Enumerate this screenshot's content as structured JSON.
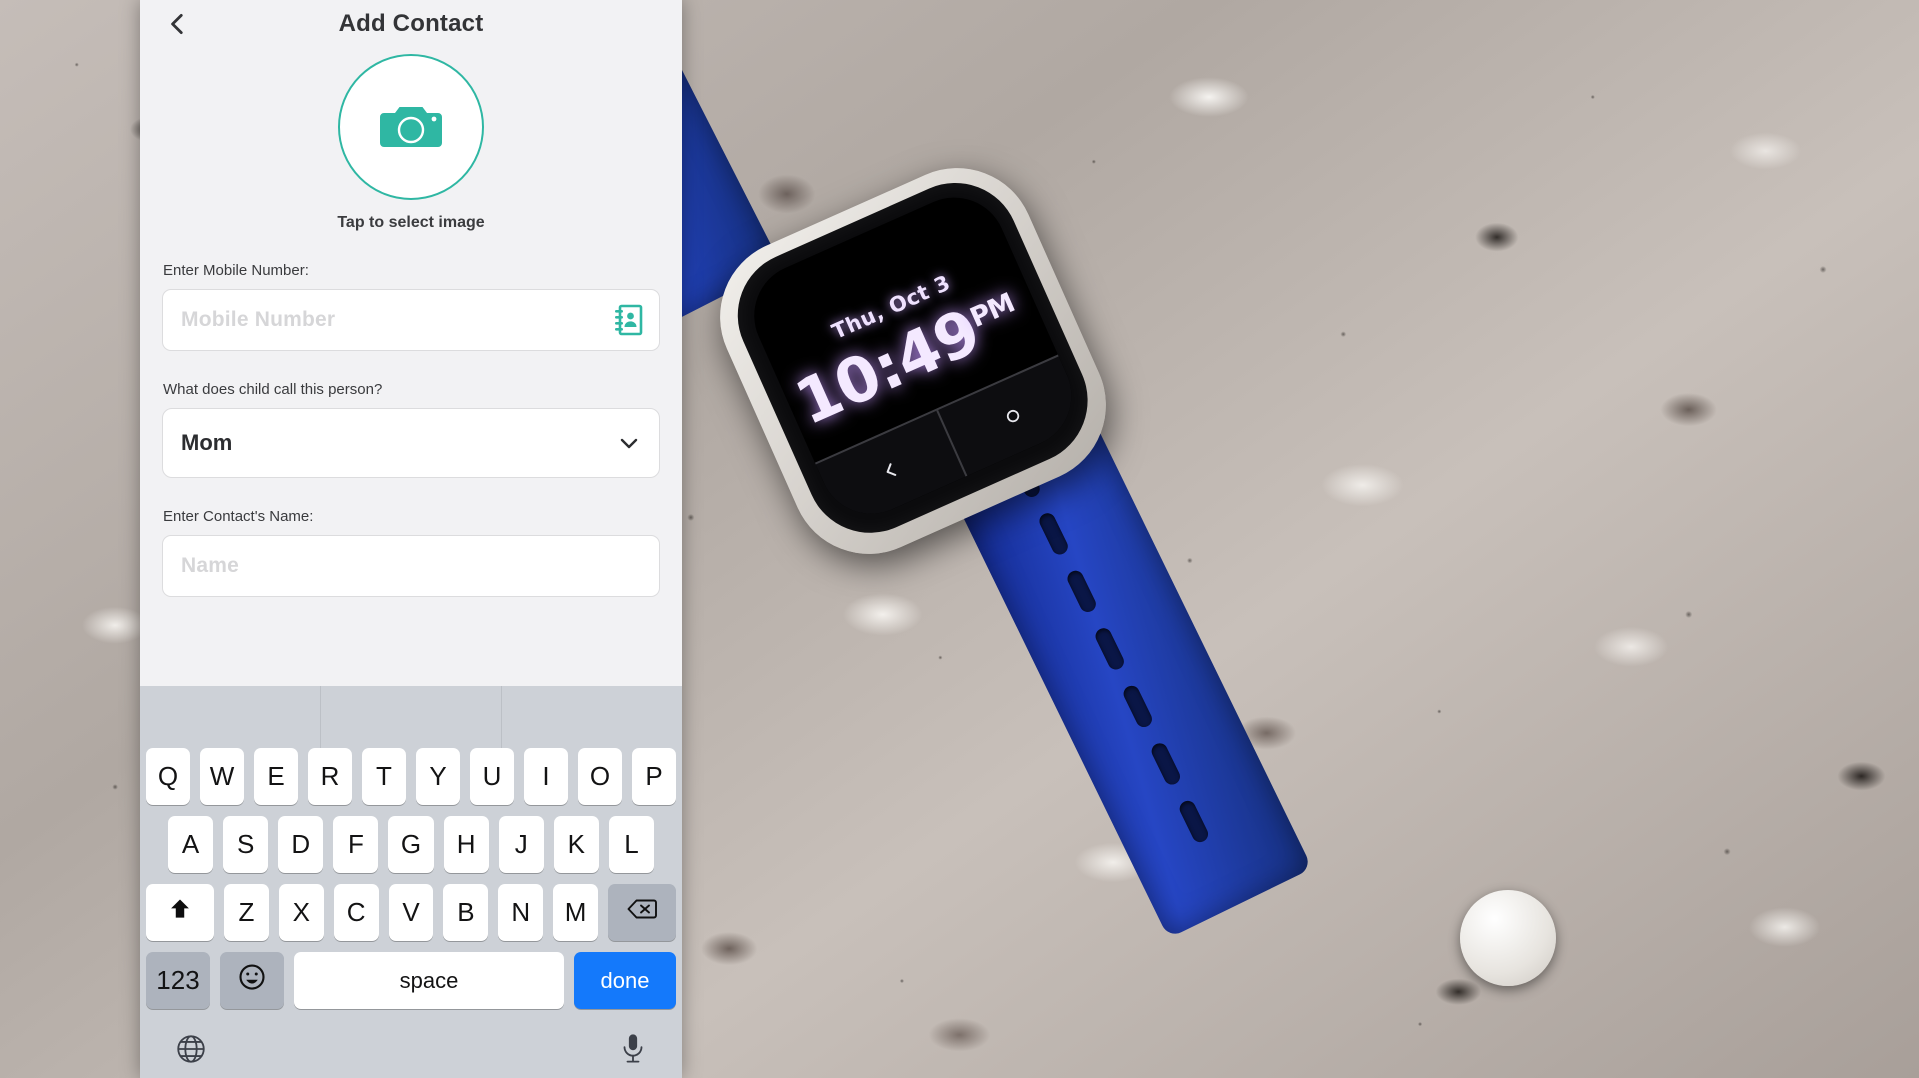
{
  "background": {
    "description": "photo of a blue-strap kids smartwatch on a granite countertop",
    "watch": {
      "date": "Thu, Oct 3",
      "time": "10:49",
      "ampm": "PM",
      "nav_back_icon": "chevron-left-icon",
      "nav_home_icon": "circle-icon"
    },
    "colors": {
      "strap": "#1b39a8",
      "screen": "#000000",
      "time_text": "#f4e9ff"
    }
  },
  "app": {
    "navbar": {
      "back_icon": "chevron-left-icon",
      "title": "Add Contact"
    },
    "avatar": {
      "icon": "camera-icon",
      "caption": "Tap to select image",
      "accent": "#2fb7a3"
    },
    "form": {
      "mobile": {
        "label": "Enter Mobile Number:",
        "placeholder": "Mobile Number",
        "value": "",
        "trailing_icon": "contacts-book-icon"
      },
      "relation": {
        "label": "What does child call this person?",
        "value": "Mom",
        "chevron_icon": "chevron-down-icon",
        "options": [
          "Mom"
        ]
      },
      "name": {
        "label": "Enter Contact's Name:",
        "placeholder": "Name",
        "value": ""
      }
    }
  },
  "keyboard": {
    "predictions": [
      "",
      "",
      ""
    ],
    "row1": [
      "Q",
      "W",
      "E",
      "R",
      "T",
      "Y",
      "U",
      "I",
      "O",
      "P"
    ],
    "row2": [
      "A",
      "S",
      "D",
      "F",
      "G",
      "H",
      "J",
      "K",
      "L"
    ],
    "row3_letters": [
      "Z",
      "X",
      "C",
      "V",
      "B",
      "N",
      "M"
    ],
    "shift_icon": "shift-arrow-icon",
    "backspace_icon": "backspace-icon",
    "numbers_key": "123",
    "emoji_icon": "emoji-smiley-icon",
    "space_key": "space",
    "return_key": "done",
    "globe_icon": "globe-icon",
    "dictation_icon": "microphone-icon",
    "colors": {
      "background": "#cdd1d7",
      "key": "#ffffff",
      "modifier": "#adb3bd",
      "action": "#1479fb"
    }
  }
}
